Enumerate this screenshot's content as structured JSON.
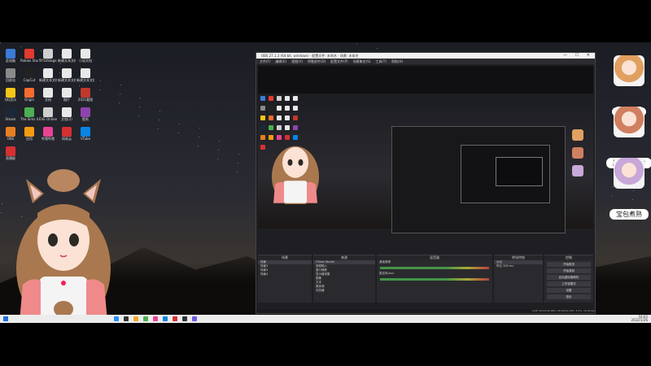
{
  "desktop": {
    "icons": [
      {
        "label": "此电脑",
        "color": "#3a7bd5"
      },
      {
        "label": "Roblox Studio",
        "color": "#e23b2e"
      },
      {
        "label": "SY50Stage 中文",
        "color": "#cfcfcf"
      },
      {
        "label": "新建文本文档",
        "color": "#e8e8e8"
      },
      {
        "label": "小说文档",
        "color": "#e8e8e8"
      },
      {
        "label": "回收站",
        "color": "#8a8a8a"
      },
      {
        "label": "CapCut",
        "color": "#222222"
      },
      {
        "label": "新建文本文档(2)",
        "color": "#e8e8e8"
      },
      {
        "label": "新建文本文档(3)",
        "color": "#e8e8e8"
      },
      {
        "label": "新建文本文档(4)",
        "color": "#e8e8e8"
      },
      {
        "label": "QQ音乐",
        "color": "#f5c518"
      },
      {
        "label": "Origin",
        "color": "#f56c2d"
      },
      {
        "label": "文档",
        "color": "#e8e8e8"
      },
      {
        "label": "图片",
        "color": "#e8e8e8"
      },
      {
        "label": "2021截图",
        "color": "#c0392b"
      },
      {
        "label": "Steam",
        "color": "#1b2838"
      },
      {
        "label": "The Sims 4",
        "color": "#4caf50"
      },
      {
        "label": "EVE Online",
        "color": "#cfcfcf"
      },
      {
        "label": "文档(2)",
        "color": "#e8e8e8"
      },
      {
        "label": "壁纸",
        "color": "#8e44ad"
      },
      {
        "label": "OBS",
        "color": "#e67e22"
      },
      {
        "label": "应用",
        "color": "#f39c12"
      },
      {
        "label": "哔哩哔哩",
        "color": "#e84393"
      },
      {
        "label": "网易云",
        "color": "#d63031"
      },
      {
        "label": "VTube",
        "color": "#0984e3"
      },
      {
        "label": "直播姬",
        "color": "#d63031"
      }
    ]
  },
  "obs": {
    "title": "OBS 27.1.3 (64-bit, windows) - 配置文件: 未命名 - 场景: 未命名",
    "window_controls": "— ☐ ✕",
    "menu": [
      "文件(F)",
      "编辑(E)",
      "视图(V)",
      "停靠部件(D)",
      "配置文件(P)",
      "场景集合(S)",
      "工具(T)",
      "帮助(H)"
    ],
    "panels": {
      "scenes": {
        "title": "场景",
        "items": [
          "场景",
          "场景2",
          "场景3",
          "场景4"
        ]
      },
      "sources": {
        "title": "来源",
        "items": [
          "VTube Studio",
          "音频输入",
          "窗口捕获",
          "显示器采集",
          "图像",
          "文本",
          "媒体源",
          "浏览器"
        ]
      },
      "mixer": {
        "title": "混音器",
        "channels": [
          "桌面音频",
          "麦克风/Aux"
        ]
      },
      "transitions": {
        "title": "转场特效",
        "items": [
          "淡出",
          "时长 300 ms"
        ]
      },
      "controls": {
        "title": "控制",
        "buttons": [
          "开始推流",
          "开始录制",
          "启动虚拟摄像机",
          "工作室模式",
          "设置",
          "退出"
        ]
      }
    },
    "status": "LIVE: 00:00:00   REC: 00:00:00   CPU: 3.2%, 30.00 fps"
  },
  "side_avatars": [
    {
      "name": "FyLiew",
      "color": "#e0a060"
    },
    {
      "name": "厨口小画珍",
      "color": "#d08060"
    },
    {
      "name": "宝包煮熟",
      "color": "#c8a8d8"
    }
  ],
  "taskbar": {
    "icons": [
      "#1e90ff",
      "#333",
      "#f5a623",
      "#4caf50",
      "#e84393",
      "#0984e3",
      "#d63031",
      "#2d3436",
      "#6c5ce7"
    ],
    "clock": "16:02",
    "date": "2022/1/26"
  }
}
